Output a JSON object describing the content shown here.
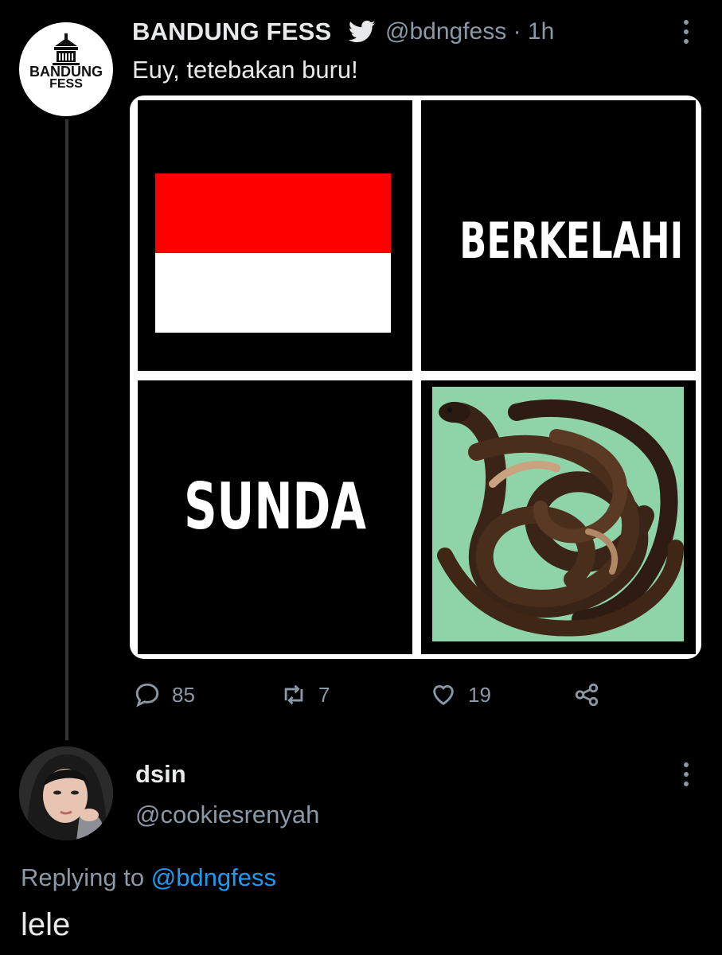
{
  "tweet": {
    "author": {
      "name": "BANDUNG FESS",
      "handle": "@bdngfess",
      "time": "· 1h",
      "verified_icon": "bird-icon"
    },
    "avatar_text": {
      "line1": "BANDUNG",
      "line2": "FESS"
    },
    "text": "Euy, tetebakan buru!",
    "image": {
      "cells": [
        {
          "kind": "flag",
          "colors": [
            "#ff0000",
            "#ffffff"
          ]
        },
        {
          "kind": "word",
          "text": "BERKELAHI"
        },
        {
          "kind": "word",
          "text": "SUNDA"
        },
        {
          "kind": "photo",
          "subject": "eels"
        }
      ]
    },
    "actions": {
      "reply_count": "85",
      "retweet_count": "7",
      "like_count": "19"
    }
  },
  "reply": {
    "name": "dsin",
    "handle": "@cookiesrenyah",
    "replying_prefix": "Replying to ",
    "replying_to": "@bdngfess",
    "text": "lele"
  },
  "colors": {
    "background": "#000000",
    "text": "#e7e9ea",
    "muted": "#8b98a5",
    "link": "#1d9bf0"
  }
}
